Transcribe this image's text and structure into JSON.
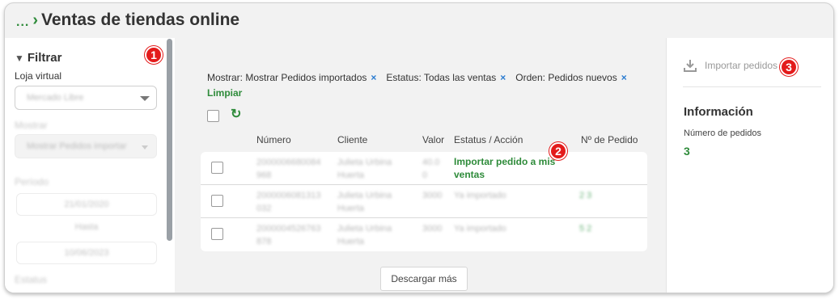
{
  "header": {
    "breadcrumb_dots": "...",
    "breadcrumb_chevron": "›",
    "title": "Ventas de tiendas online"
  },
  "sidebar": {
    "filter_title": "Filtrar",
    "store_label": "Loja virtual",
    "store_value": "Mercado Libre",
    "show_label": "Mostrar",
    "show_value": "Mostrar Pedidos importar",
    "period_label": "Período",
    "date_from": "21/01/2020",
    "until_label": "Hasta",
    "date_to": "10/06/2023",
    "status_label": "Estatus"
  },
  "filters": {
    "show": "Mostrar: Mostrar Pedidos importados",
    "status": "Estatus: Todas las ventas",
    "order": "Orden: Pedidos nuevos",
    "remove_symbol": "×",
    "clear": "Limpiar"
  },
  "table": {
    "refresh_symbol": "↻",
    "headers": {
      "number": "Número",
      "client": "Cliente",
      "value": "Valor",
      "status": "Estatus / Acción",
      "order_no": "Nº de Pedido"
    },
    "rows": [
      {
        "number": "2000006680084 968",
        "client": "Julieta Urbina Huerta",
        "value": "40.0 0",
        "action": "Importar pedido a mis ventas",
        "order_no": ""
      },
      {
        "number": "2000006081313 032",
        "client": "Julieta Urbina Huerta",
        "value": "3000",
        "status": "Ya importado",
        "order_no": "2 3"
      },
      {
        "number": "2000004526763 878",
        "client": "Julieta Urbina Huerta",
        "value": "3000",
        "status": "Ya importado",
        "order_no": "5 2"
      }
    ],
    "load_more": "Descargar más"
  },
  "right_panel": {
    "import_button": "Importar pedidos",
    "info_title": "Información",
    "orders_label": "Número de pedidos",
    "orders_value": "3"
  },
  "markers": [
    "1",
    "2",
    "3"
  ],
  "colors": {
    "accent_green": "#2e8b3a",
    "remove_blue": "#2a7bd0",
    "marker_red": "#e31b1b"
  }
}
